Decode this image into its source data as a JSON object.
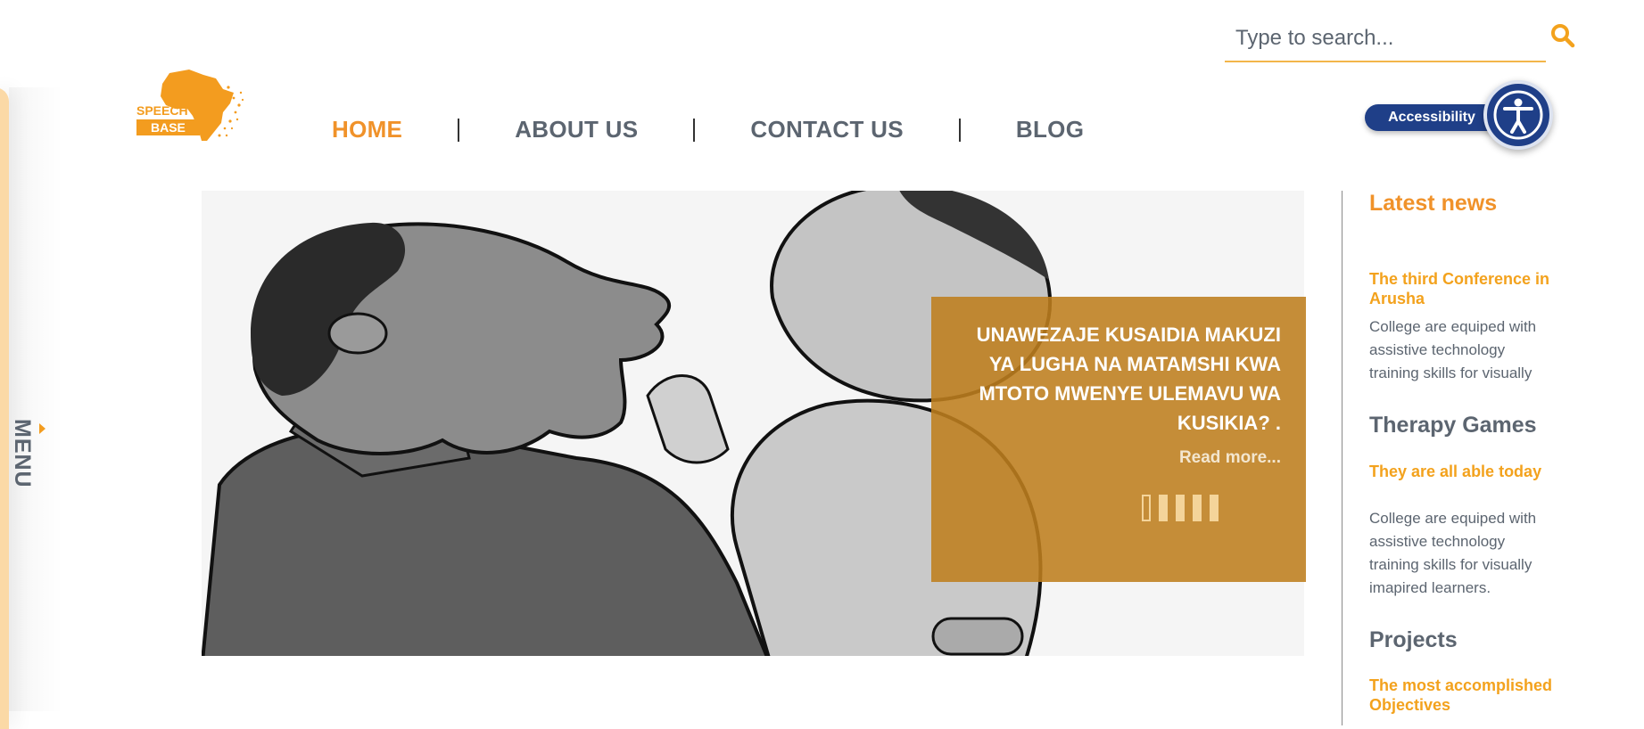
{
  "side_menu": {
    "label": "MENU"
  },
  "search": {
    "placeholder": "Type to search..."
  },
  "logo": {
    "line1": "SPEECH",
    "line2": "BASE"
  },
  "nav": [
    {
      "label": "HOME",
      "active": true
    },
    {
      "label": "ABOUT US",
      "active": false
    },
    {
      "label": "CONTACT US",
      "active": false
    },
    {
      "label": "BLOG",
      "active": false
    }
  ],
  "accessibility": {
    "label": "Accessibility"
  },
  "hero": {
    "heading": "UNAWEZAJE KUSAIDIA MAKUZI YA LUGHA NA MATAMSHI KWA MTOTO MWENYE ULEMAVU WA KUSIKIA? .",
    "read_more": "Read more...",
    "slides_count": 5,
    "active_slide": 1
  },
  "sidebar": {
    "latest_news_title": "Latest news",
    "news_link": "The third Conference in Arusha",
    "news_text": "College are equiped with assistive technology training skills for visually",
    "therapy_title": "Therapy Games",
    "therapy_link": "They are all able today",
    "therapy_text": "College are equiped with assistive technology training skills for visually imapired learners.",
    "projects_title": "Projects",
    "projects_link": "The most accomplished Objectives"
  },
  "colors": {
    "accent": "#f0922a",
    "text": "#5c6570",
    "a11y": "#1f3f88",
    "caption": "#be7e1e"
  }
}
